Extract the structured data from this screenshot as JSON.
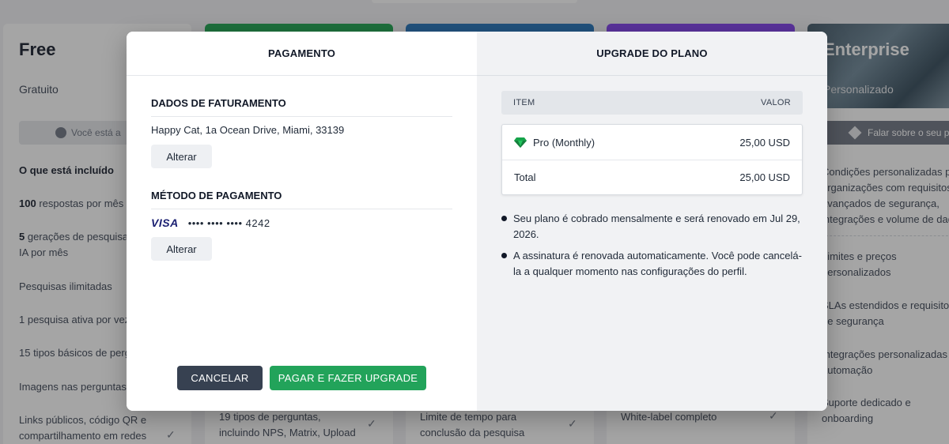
{
  "background": {
    "free_card": {
      "title": "Free",
      "subtitle": "Gratuito",
      "current_button": "Você está a",
      "included_title": "O que está incluído",
      "features": [
        {
          "bold": "100",
          "text": " respostas por mês"
        },
        {
          "bold": "5",
          "text": " gerações de pesquisas IA por mês"
        },
        {
          "bold": "",
          "text": "Pesquisas ilimitadas"
        },
        {
          "bold": "",
          "text": "1 pesquisa ativa por vez"
        },
        {
          "bold": "",
          "text": "15 tipos básicos de pergu"
        },
        {
          "bold": "",
          "text": "Imagens nas perguntas"
        },
        {
          "bold": "",
          "text": "Links públicos, código QR e compartilhamento em redes"
        }
      ]
    },
    "green_card_bottom": "19 tipos de perguntas, incluindo NPS, Matrix, Upload",
    "blue_card_bottom": "Limite de tempo para conclusão da pesquisa",
    "purple_card_bottom": "White-label completo",
    "enterprise_card": {
      "title": "Enterprise",
      "subtitle": "Personalizado",
      "contact_button": "Falar sobre o seu pla",
      "features": [
        "Condições personalizadas p organizações com requisitos avançados de segurança, integrações e volume de dad",
        "Limites e preços personalizados",
        "SLAs estendidos e requisitos de segurança",
        "Integrações personalizadas e automação",
        "Suporte dedicado e onboarding"
      ]
    },
    "check_glyph": "✓"
  },
  "modal": {
    "payment": {
      "header": "PAGAMENTO",
      "billing_title": "DADOS DE FATURAMENTO",
      "address": "Happy Cat, 1a Ocean Drive, Miami, 33139",
      "change_billing_label": "Alterar",
      "method_title": "MÉTODO DE PAGAMENTO",
      "card_brand": "VISA",
      "card_number": "•••• •••• •••• 4242",
      "change_method_label": "Alterar",
      "cancel_label": "CANCELAR",
      "pay_label": "PAGAR E FAZER UPGRADE"
    },
    "upgrade": {
      "header": "UPGRADE DO PLANO",
      "col_item": "ITEM",
      "col_value": "VALOR",
      "rows": [
        {
          "item": "Pro (Monthly)",
          "value": "25,00 USD"
        },
        {
          "item": "Total",
          "value": "25,00 USD"
        }
      ],
      "notes": [
        "Seu plano é cobrado mensalmente e será renovado em Jul 29, 2026.",
        "A assinatura é renovada automaticamente. Você pode cancelá-la a qualquer momento nas configurações do perfil."
      ]
    }
  },
  "colors": {
    "pay_button": "#22a35a",
    "cancel_button": "#374151",
    "visa": "#1a1f71",
    "gem": "#16a34a"
  },
  "icons": {
    "plan_item": "gem-icon",
    "card_brand": "visa-logo"
  }
}
